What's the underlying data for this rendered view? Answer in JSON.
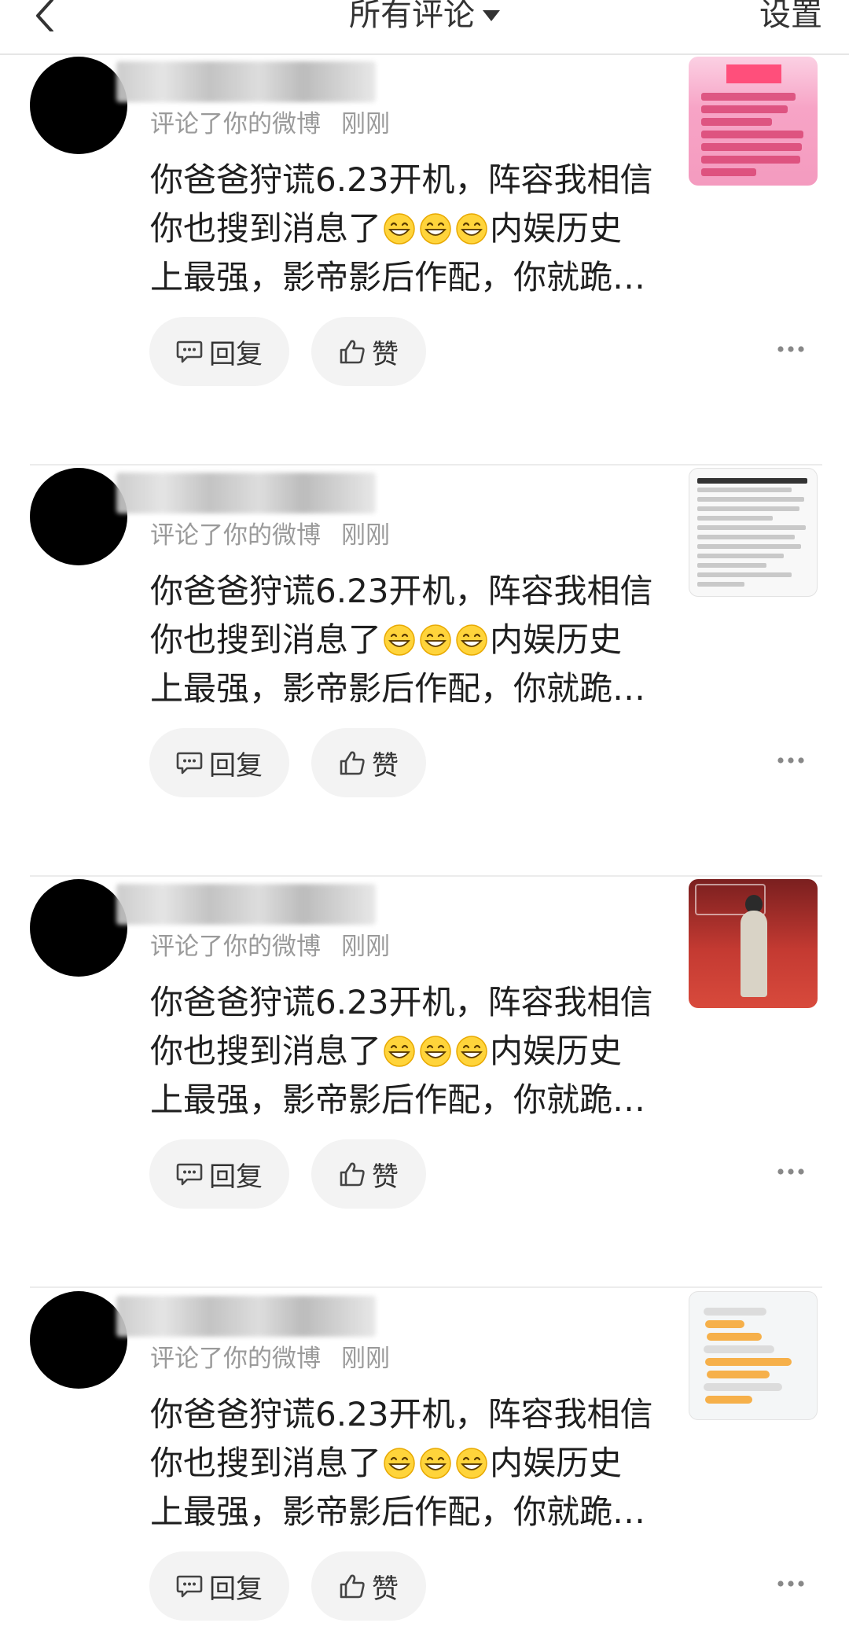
{
  "topbar": {
    "title": "所有评论",
    "settings": "设置"
  },
  "colors": {
    "avatar": "#000000",
    "button_bg": "#f3f3f3",
    "meta_text": "#9a9a9a",
    "divider": "#ececec"
  },
  "comments": [
    {
      "meta": "评论了你的微博",
      "time": "刚刚",
      "lines": [
        "你爸爸狩谎6.23开机，阵容我相信",
        "你也搜到消息了",
        "内娱历史",
        "上最强，影帝影后作配，你就跪…"
      ],
      "reply_label": "回复",
      "like_label": "赞",
      "thumb_icon": "poster-thumbnail-icon"
    },
    {
      "meta": "评论了你的微博",
      "time": "刚刚",
      "lines": [
        "你爸爸狩谎6.23开机，阵容我相信",
        "你也搜到消息了",
        "内娱历史",
        "上最强，影帝影后作配，你就跪…"
      ],
      "reply_label": "回复",
      "like_label": "赞",
      "thumb_icon": "article-thumbnail-icon"
    },
    {
      "meta": "评论了你的微博",
      "time": "刚刚",
      "lines": [
        "你爸爸狩谎6.23开机，阵容我相信",
        "你也搜到消息了",
        "内娱历史",
        "上最强，影帝影后作配，你就跪…"
      ],
      "reply_label": "回复",
      "like_label": "赞",
      "thumb_icon": "photo-thumbnail-icon"
    },
    {
      "meta": "评论了你的微博",
      "time": "刚刚",
      "lines": [
        "你爸爸狩谎6.23开机，阵容我相信",
        "你也搜到消息了",
        "内娱历史",
        "上最强，影帝影后作配，你就跪…"
      ],
      "reply_label": "回复",
      "like_label": "赞",
      "thumb_icon": "chat-screenshot-thumbnail-icon"
    }
  ]
}
